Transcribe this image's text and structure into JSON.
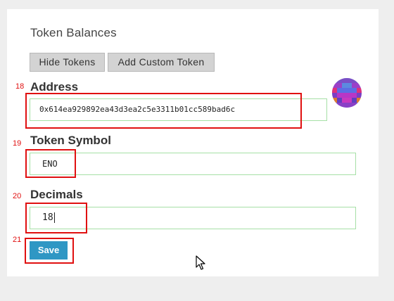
{
  "panel": {
    "title": "Token Balances"
  },
  "buttons": {
    "hide_tokens": "Hide Tokens",
    "add_custom_token": "Add Custom Token",
    "save": "Save"
  },
  "form": {
    "address": {
      "label": "Address",
      "value": "0x614ea929892ea43d3ea2c5e3311b01cc589bad6c"
    },
    "symbol": {
      "label": "Token Symbol",
      "value": "ENO"
    },
    "decimals": {
      "label": "Decimals",
      "value": "18"
    }
  },
  "markers": [
    "18",
    "19",
    "20",
    "21"
  ],
  "colors": {
    "accent": "#2f97c4",
    "highlight": "#e01010",
    "input_border": "#a6e0a6",
    "button_bg": "#d3d3d3"
  },
  "icons": {
    "avatar": "identicon-icon",
    "pointer": "mouse-cursor-icon"
  }
}
